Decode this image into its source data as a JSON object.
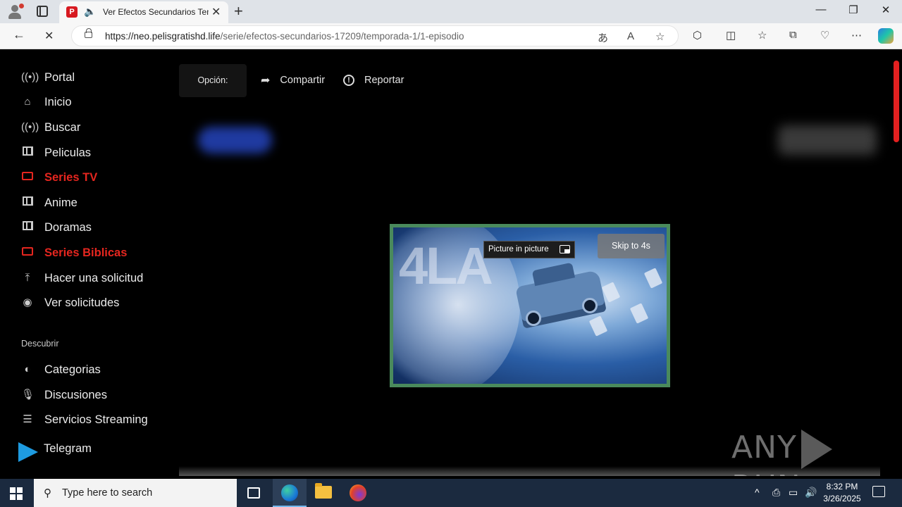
{
  "browser": {
    "tab_title": "Ver Efectos Secundarios Tem",
    "tab_favicon": "P",
    "url_host": "https://neo.pelisgratishd.life",
    "url_path": "/serie/efectos-secundarios-17209/temporada-1/1-episodio",
    "new_tab": "+",
    "back": "←",
    "reload": "✕",
    "minimize": "—",
    "restore": "❐",
    "close": "✕"
  },
  "sidebar": {
    "items": [
      {
        "label": "Portal",
        "icon": "broadcast-icon"
      },
      {
        "label": "Inicio",
        "icon": "home-icon"
      },
      {
        "label": "Buscar",
        "icon": "broadcast-icon"
      },
      {
        "label": "Peliculas",
        "icon": "film-icon"
      },
      {
        "label": "Series TV",
        "icon": "tv-icon",
        "active": true
      },
      {
        "label": "Anime",
        "icon": "film-icon"
      },
      {
        "label": "Doramas",
        "icon": "film-icon"
      },
      {
        "label": "Series Biblicas",
        "icon": "tv-icon",
        "active": true
      },
      {
        "label": "Hacer una solicitud",
        "icon": "upload-icon"
      },
      {
        "label": "Ver solicitudes",
        "icon": "eye-icon"
      }
    ],
    "section_title": "Descubrir",
    "discover": [
      {
        "label": "Categorias",
        "icon": "half-circle-icon"
      },
      {
        "label": "Discusiones",
        "icon": "microphone-icon"
      },
      {
        "label": "Servicios Streaming",
        "icon": "stack-icon"
      },
      {
        "label": "Telegram",
        "icon": "telegram-icon"
      }
    ]
  },
  "toolbar": {
    "option_label": "Opción:",
    "share_label": "Compartir",
    "report_label": "Reportar"
  },
  "ad": {
    "pip_label": "Picture in picture",
    "skip_label": "Skip to 4s",
    "big_text": "4LA"
  },
  "watermark": {
    "left": "ANY",
    "right": "RUN"
  },
  "taskbar": {
    "search_placeholder": "Type here to search",
    "time": "8:32 PM",
    "date": "3/26/2025"
  },
  "colors": {
    "accent_red": "#e5261f",
    "ad_border": "#4a8a5c",
    "taskbar": "#1b2a3f"
  }
}
